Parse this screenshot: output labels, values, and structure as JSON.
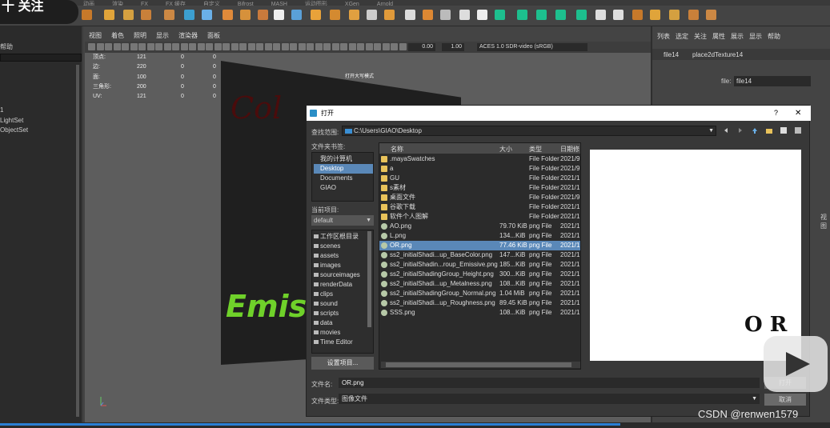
{
  "top_menu": [
    "动画",
    "渲染",
    "FX",
    "FX 缓存",
    "自定义",
    "Bifrost",
    "MASH",
    "运动图形",
    "XGen",
    "Arnold"
  ],
  "follow_badge": "十 关注",
  "left_panel": {
    "help": "帮助",
    "items": [
      "1",
      "LightSet",
      "ObjectSet"
    ]
  },
  "viewport": {
    "menu": [
      "视图",
      "着色",
      "照明",
      "显示",
      "渲染器",
      "面板"
    ],
    "field1": "0.00",
    "field2": "1.00",
    "colorspace": "ACES 1.0 SDR-video (sRGB)",
    "panel_label": "打开大写模式",
    "hud": [
      {
        "label": "顶点:",
        "a": "121",
        "b": "0",
        "c": "0"
      },
      {
        "label": "边:",
        "a": "220",
        "b": "0",
        "c": "0"
      },
      {
        "label": "面:",
        "a": "100",
        "b": "0",
        "c": "0"
      },
      {
        "label": "三角形:",
        "a": "200",
        "b": "0",
        "c": "0"
      },
      {
        "label": "UV:",
        "a": "121",
        "b": "0",
        "c": "0"
      }
    ],
    "camera": "persp"
  },
  "right_panel": {
    "menu": [
      "列表",
      "选定",
      "关注",
      "属性",
      "展示",
      "显示",
      "帮助"
    ],
    "tabs": [
      "file14",
      "place2dTexture14"
    ],
    "file_label": "file:",
    "file_value": "file14",
    "side_label": "视图"
  },
  "dialog": {
    "title": "打开",
    "help": "?",
    "close": "✕",
    "look_label": "查找范围:",
    "look_path": "C:\\Users\\GIAO\\Desktop",
    "bookmarks_label": "文件夹书签:",
    "bookmarks": [
      "我的计算机",
      "Desktop",
      "Documents",
      "GIAO"
    ],
    "bookmark_selected": 1,
    "project_label": "当前项目:",
    "project_value": "default",
    "project_items": [
      "工作区根目录",
      "scenes",
      "assets",
      "images",
      "sourceimages",
      "renderData",
      "clips",
      "sound",
      "scripts",
      "data",
      "movies",
      "Time Editor"
    ],
    "settings_button": "设置项目...",
    "columns": [
      "名称",
      "大小",
      "类型",
      "日期修"
    ],
    "files": [
      {
        "name": ".mayaSwatches",
        "size": "",
        "type": "File Folder",
        "date": "2021/9,",
        "kind": "folder"
      },
      {
        "name": "a",
        "size": "",
        "type": "File Folder",
        "date": "2021/9,",
        "kind": "folder"
      },
      {
        "name": "GU",
        "size": "",
        "type": "File Folder",
        "date": "2021/1(",
        "kind": "folder"
      },
      {
        "name": "s素材",
        "size": "",
        "type": "File Folder",
        "date": "2021/1(",
        "kind": "folder"
      },
      {
        "name": "桌面文件",
        "size": "",
        "type": "File Folder",
        "date": "2021/9,",
        "kind": "folder"
      },
      {
        "name": "谷歌下载",
        "size": "",
        "type": "File Folder",
        "date": "2021/1(",
        "kind": "folder"
      },
      {
        "name": "软件个人图解",
        "size": "",
        "type": "File Folder",
        "date": "2021/1(",
        "kind": "folder"
      },
      {
        "name": "AO.png",
        "size": "79.70 KiB",
        "type": "png File",
        "date": "2021/1(",
        "kind": "img"
      },
      {
        "name": "L.png",
        "size": "134...KiB",
        "type": "png File",
        "date": "2021/1(",
        "kind": "img"
      },
      {
        "name": "OR.png",
        "size": "77.46 KiB",
        "type": "png File",
        "date": "2021/1(",
        "kind": "img"
      },
      {
        "name": "ss2_initialShadi...up_BaseColor.png",
        "size": "147...KiB",
        "type": "png File",
        "date": "2021/1(",
        "kind": "img"
      },
      {
        "name": "ss2_initialShadin...roup_Emissive.png",
        "size": "185...KiB",
        "type": "png File",
        "date": "2021/1(",
        "kind": "img"
      },
      {
        "name": "ss2_initialShadingGroup_Height.png",
        "size": "300...KiB",
        "type": "png File",
        "date": "2021/1(",
        "kind": "img"
      },
      {
        "name": "ss2_initialShadi...up_Metalness.png",
        "size": "108...KiB",
        "type": "png File",
        "date": "2021/1(",
        "kind": "img"
      },
      {
        "name": "ss2_initialShadingGroup_Normal.png",
        "size": "1.04 MiB",
        "type": "png File",
        "date": "2021/1(",
        "kind": "img"
      },
      {
        "name": "ss2_initialShadi...up_Roughness.png",
        "size": "89.45 KiB",
        "type": "png File",
        "date": "2021/1(",
        "kind": "img"
      },
      {
        "name": "SSS.png",
        "size": "108...KiB",
        "type": "png File",
        "date": "2021/1(",
        "kind": "img"
      }
    ],
    "file_selected": 9,
    "preview_text": "O R",
    "filename_label": "文件名:",
    "filename_value": "OR.png",
    "open_button": "打开",
    "filetype_label": "文件类型:",
    "filetype_value": "图像文件",
    "cancel_button": "取消"
  },
  "canvas_text": {
    "top": "Col",
    "bottom": "Emis"
  },
  "watermark": "CSDN @renwen1579",
  "colors": {
    "accent": "#5a88b8",
    "progress": "#2a7fd4",
    "folder": "#e8c25a",
    "emis_green": "#6fd12a",
    "col_red": "#4a0c0c"
  }
}
